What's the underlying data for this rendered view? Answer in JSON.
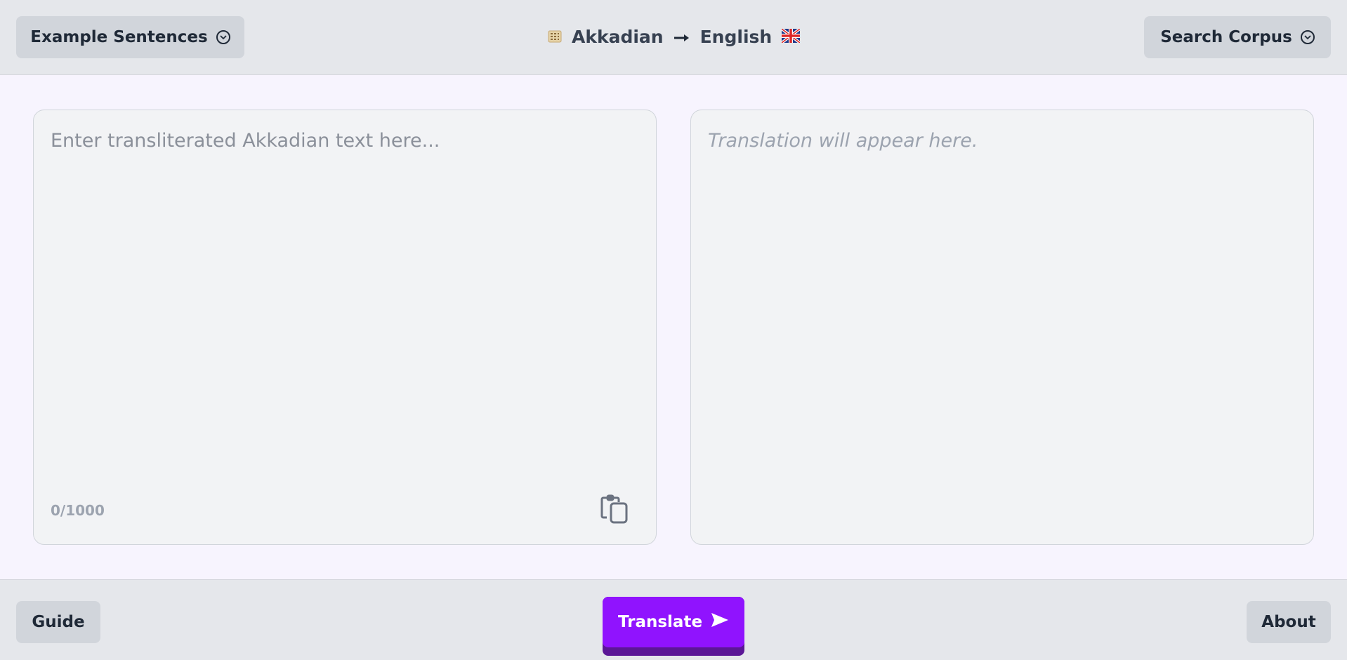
{
  "header": {
    "examples_label": "Example Sentences",
    "source_language": "Akkadian",
    "target_language": "English",
    "search_label": "Search Corpus"
  },
  "input": {
    "placeholder": "Enter transliterated Akkadian text here...",
    "char_count": "0/1000"
  },
  "output": {
    "placeholder": "Translation will appear here."
  },
  "footer": {
    "guide_label": "Guide",
    "translate_label": "Translate",
    "about_label": "About"
  },
  "icons": {
    "dropdown": "chevron-down-circle",
    "source_flag": "cuneiform-tablet",
    "arrow": "arrow-right",
    "target_flag": "uk-flag",
    "paste": "clipboard",
    "send": "send-arrow"
  },
  "colors": {
    "accent": "#9013fe",
    "accent_shadow": "#5b1796",
    "bar_bg": "#e5e7eb",
    "page_bg": "#f7f4fe"
  }
}
